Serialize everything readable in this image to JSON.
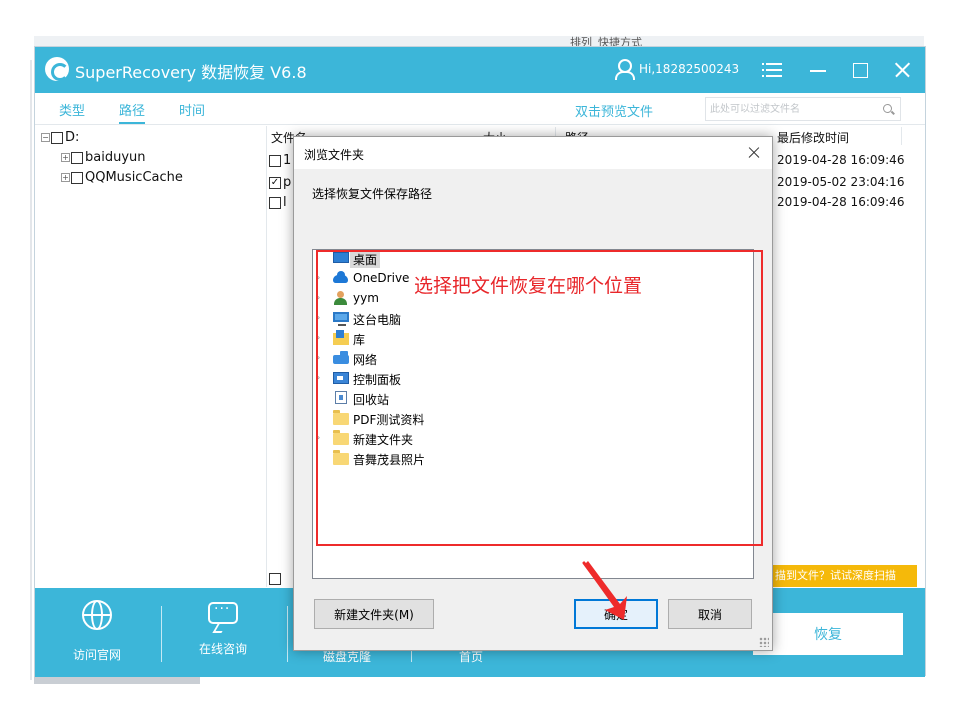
{
  "background": {
    "strip_fragment_1": "排列",
    "strip_fragment_2": "快捷方式"
  },
  "app": {
    "title": "SuperRecovery 数据恢复 V6.8",
    "user": "Hi,18282500243",
    "accent_color": "#3cb6d9"
  },
  "tabs": [
    {
      "label": "类型"
    },
    {
      "label": "路径",
      "active": true
    },
    {
      "label": "时间"
    }
  ],
  "preview_link": "双击预览文件",
  "filter_placeholder": "此处可以过滤文件名",
  "tree": {
    "root": "D:",
    "children": [
      {
        "label": "baiduyun"
      },
      {
        "label": "QQMusicCache"
      }
    ]
  },
  "file_list": {
    "columns": {
      "name": "文件名",
      "size": "大小",
      "path": "路径",
      "modified": "最后修改时间"
    },
    "rows": [
      {
        "name_fragment": "1",
        "checked": false,
        "modified": "2019-04-28 16:09:46"
      },
      {
        "name_fragment": "p",
        "checked": true,
        "modified": "2019-05-02 23:04:16"
      },
      {
        "name_fragment": "l",
        "checked": false,
        "modified": "2019-04-28 16:09:46"
      }
    ]
  },
  "deep_scan_link": "描到文件？试试深度扫描",
  "bottom": {
    "items": [
      {
        "label": "访问官网",
        "icon": "globe-icon"
      },
      {
        "label": "在线咨询",
        "icon": "chat-icon"
      }
    ],
    "hidden_labels": [
      "磁盘克隆",
      "首页"
    ],
    "recover_label": "恢复"
  },
  "dialog": {
    "title": "浏览文件夹",
    "prompt": "选择恢复文件保存路径",
    "folders": [
      {
        "label": "桌面",
        "icon": "desktop-icon",
        "selected": true
      },
      {
        "label": "OneDrive",
        "icon": "onedrive-icon",
        "expandable": true
      },
      {
        "label": "yym",
        "icon": "user-icon",
        "expandable": true
      },
      {
        "label": "这台电脑",
        "icon": "computer-icon",
        "expandable": true
      },
      {
        "label": "库",
        "icon": "library-icon",
        "expandable": true
      },
      {
        "label": "网络",
        "icon": "network-icon",
        "expandable": true
      },
      {
        "label": "控制面板",
        "icon": "control-panel-icon",
        "expandable": true
      },
      {
        "label": "回收站",
        "icon": "recycle-bin-icon",
        "expandable": false
      },
      {
        "label": "PDF测试资料",
        "icon": "folder-icon",
        "expandable": false
      },
      {
        "label": "新建文件夹",
        "icon": "folder-icon",
        "expandable": true
      },
      {
        "label": "音舞茂县照片",
        "icon": "folder-icon",
        "expandable": false
      }
    ],
    "new_folder_label": "新建文件夹(M)",
    "ok_label": "确定",
    "cancel_label": "取消"
  },
  "annotation": {
    "text": "选择把文件恢复在哪个位置",
    "color": "#ee2b2b"
  }
}
